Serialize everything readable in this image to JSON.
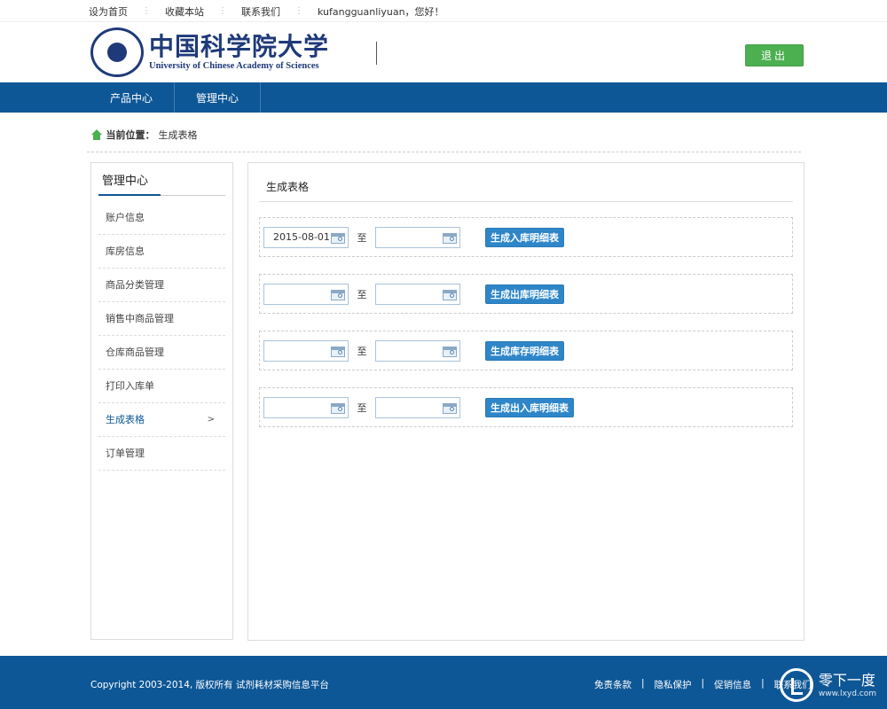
{
  "topbar": {
    "set_home": "设为首页",
    "bookmark": "收藏本站",
    "contact": "联系我们",
    "greeting": "kufangguanliyuan，您好！"
  },
  "header": {
    "logo_cn": "中国科学院大学",
    "logo_en": "University of Chinese Academy of Sciences",
    "logout_label": "退出"
  },
  "nav": {
    "items": [
      {
        "label": "产品中心"
      },
      {
        "label": "管理中心"
      }
    ]
  },
  "breadcrumb": {
    "label": "当前位置：",
    "current": "生成表格"
  },
  "sidebar": {
    "title": "管理中心",
    "items": [
      {
        "label": "账户信息"
      },
      {
        "label": "库房信息"
      },
      {
        "label": "商品分类管理"
      },
      {
        "label": "销售中商品管理"
      },
      {
        "label": "仓库商品管理"
      },
      {
        "label": "打印入库单"
      },
      {
        "label": "生成表格",
        "active": true,
        "chevron": ">"
      },
      {
        "label": "订单管理"
      }
    ]
  },
  "content": {
    "title": "生成表格",
    "to_label": "至",
    "rows": [
      {
        "start": "2015-08-01",
        "end": "",
        "button": "生成入库明细表"
      },
      {
        "start": "",
        "end": "",
        "button": "生成出库明细表"
      },
      {
        "start": "",
        "end": "",
        "button": "生成库存明细表"
      },
      {
        "start": "",
        "end": "",
        "button": "生成出入库明细表"
      }
    ]
  },
  "footer": {
    "copyright": "Copyright 2003-2014, 版权所有 试剂耗材采购信息平台",
    "links": [
      "免责条款",
      "隐私保护",
      "促销信息",
      "联系我们"
    ],
    "watermark_cn": "零下一度",
    "watermark_url": "www.lxyd.com"
  },
  "colors": {
    "nav_bg": "#0e5796",
    "logout_btn": "#4caf50",
    "gen_btn": "#2e86c8"
  }
}
